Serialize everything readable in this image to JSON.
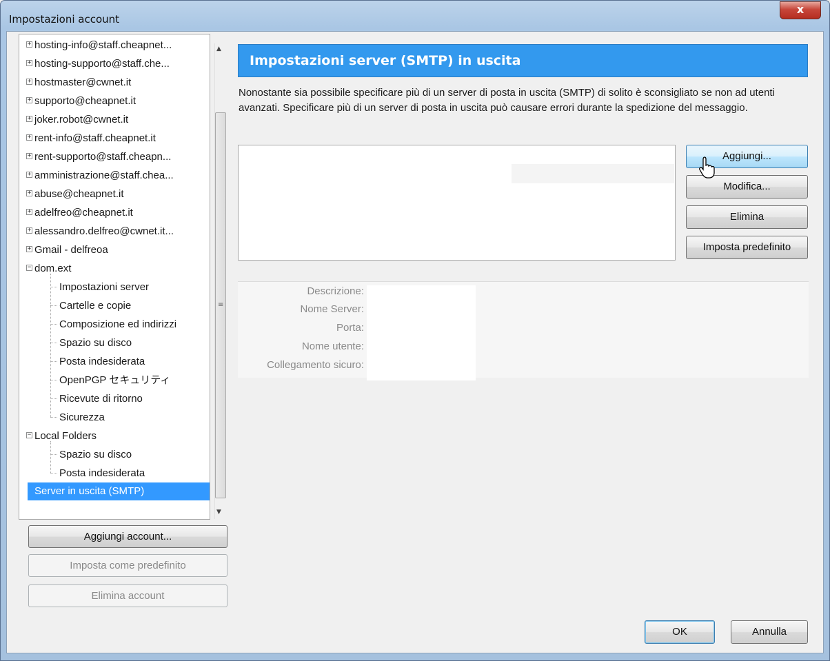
{
  "window": {
    "title": "Impostazioni account",
    "close_glyph": "x"
  },
  "tree": {
    "accounts": [
      "hosting-info@staff.cheapnet...",
      "hosting-supporto@staff.che...",
      "hostmaster@cwnet.it",
      "supporto@cheapnet.it",
      "joker.robot@cwnet.it",
      "rent-info@staff.cheapnet.it",
      "rent-supporto@staff.cheapn...",
      "amministrazione@staff.chea...",
      "abuse@cheapnet.it",
      "adelfreo@cheapnet.it",
      "alessandro.delfreo@cwnet.it...",
      "Gmail - delfreoa"
    ],
    "expanded_account": {
      "name": "dom.ext",
      "children": [
        "Impostazioni server",
        "Cartelle e copie",
        "Composizione ed indirizzi",
        "Spazio su disco",
        "Posta indesiderata",
        "OpenPGP セキュリティ",
        "Ricevute di ritorno",
        "Sicurezza"
      ]
    },
    "local_folders": {
      "name": "Local Folders",
      "children": [
        "Spazio su disco",
        "Posta indesiderata"
      ]
    },
    "selected_item": "Server in uscita (SMTP)",
    "expand_plus": "+",
    "expand_minus": "−"
  },
  "left_buttons": {
    "add_account": "Aggiungi account...",
    "set_default": "Imposta come predefinito",
    "delete_account": "Elimina account"
  },
  "panel": {
    "title": "Impostazioni server (SMTP) in uscita",
    "description": "Nonostante sia possibile specificare più di un server di posta in uscita (SMTP) di solito è sconsigliato se non ad utenti avanzati. Specificare più di un server di posta in uscita può causare errori durante la spedizione del messaggio.",
    "buttons": {
      "add": "Aggiungi...",
      "edit": "Modifica...",
      "delete": "Elimina",
      "set_default": "Imposta predefinito"
    },
    "details": {
      "description_label": "Descrizione:",
      "server_name_label": "Nome Server:",
      "port_label": "Porta:",
      "username_label": "Nome utente:",
      "secure_connection_label": "Collegamento sicuro:"
    }
  },
  "dialog_buttons": {
    "ok": "OK",
    "cancel": "Annulla"
  }
}
